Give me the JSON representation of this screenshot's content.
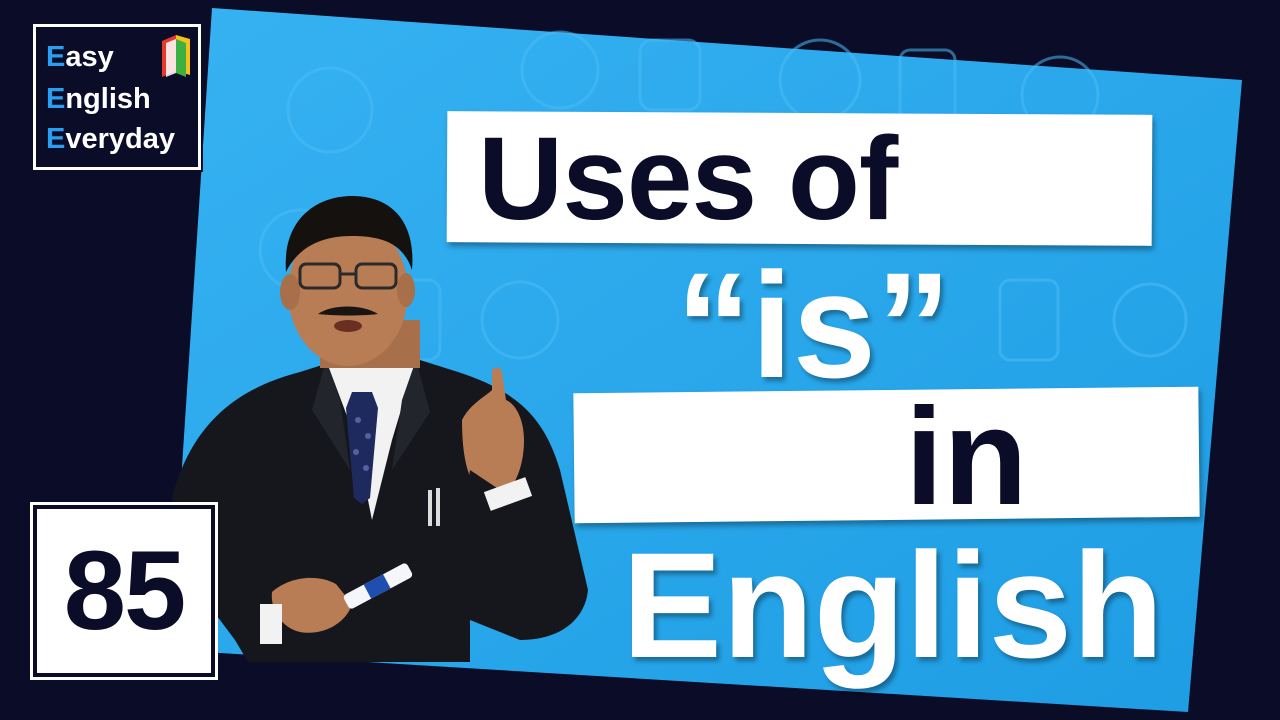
{
  "logo": {
    "lines": [
      {
        "initial": "E",
        "rest": "asy"
      },
      {
        "initial": "E",
        "rest": "nglish"
      },
      {
        "initial": "E",
        "rest": "veryday"
      }
    ],
    "icon": "book-icon"
  },
  "title": {
    "line1": "Uses of",
    "line2": "“is”",
    "line3": "in",
    "line4": "English"
  },
  "episode": {
    "number": "85"
  },
  "colors": {
    "background": "#0b0c28",
    "board": "#2aa8ec",
    "accent": "#2a9ff2",
    "text_dark": "#0b0c28",
    "text_light": "#ffffff"
  }
}
